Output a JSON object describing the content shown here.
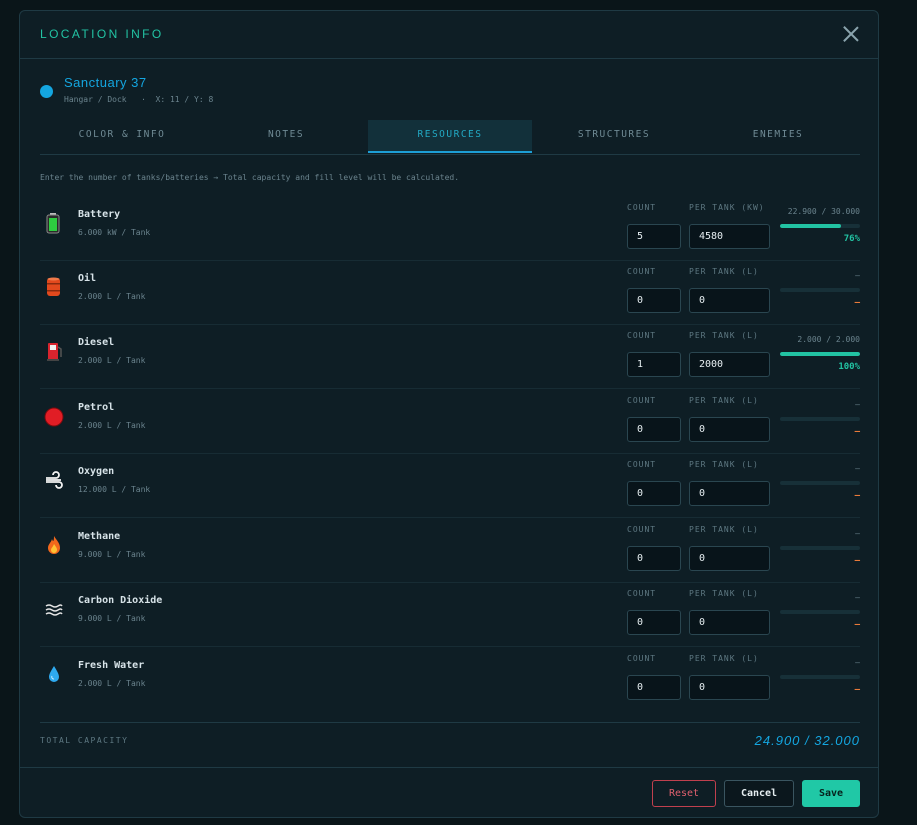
{
  "modal": {
    "title": "LOCATION INFO"
  },
  "location": {
    "name": "Sanctuary 37",
    "subtitle": "Hangar / Dock   ·  X: 11 / Y: 8",
    "color": "#14a6e0"
  },
  "tabs": [
    {
      "label": "COLOR & INFO",
      "active": false
    },
    {
      "label": "NOTES",
      "active": false
    },
    {
      "label": "RESOURCES",
      "active": true
    },
    {
      "label": "STRUCTURES",
      "active": false
    },
    {
      "label": "ENEMIES",
      "active": false
    }
  ],
  "hint": "Enter the number of tanks/batteries → Total capacity and fill level will be calculated.",
  "resources": [
    {
      "name": "Battery",
      "sub": "6.000 kW / Tank",
      "icon": "battery-icon",
      "count_label": "COUNT",
      "per_label": "PER TANK (KW)",
      "count": "5",
      "per": "4580",
      "fill": "22.900 / 30.000",
      "level": 0.76,
      "pct": "76%"
    },
    {
      "name": "Oil",
      "sub": "2.000 L / Tank",
      "icon": "oil-barrel-icon",
      "count_label": "COUNT",
      "per_label": "PER TANK (L)",
      "count": "0",
      "per": "0",
      "fill": "—",
      "level": 0,
      "pct": "—"
    },
    {
      "name": "Diesel",
      "sub": "2.000 L / Tank",
      "icon": "fuel-pump-icon",
      "count_label": "COUNT",
      "per_label": "PER TANK (L)",
      "count": "1",
      "per": "2000",
      "fill": "2.000 / 2.000",
      "level": 1.0,
      "pct": "100%"
    },
    {
      "name": "Petrol",
      "sub": "2.000 L / Tank",
      "icon": "red-circle-icon",
      "count_label": "COUNT",
      "per_label": "PER TANK (L)",
      "count": "0",
      "per": "0",
      "fill": "—",
      "level": 0,
      "pct": "—"
    },
    {
      "name": "Oxygen",
      "sub": "12.000 L / Tank",
      "icon": "wind-icon",
      "count_label": "COUNT",
      "per_label": "PER TANK (L)",
      "count": "0",
      "per": "0",
      "fill": "—",
      "level": 0,
      "pct": "—"
    },
    {
      "name": "Methane",
      "sub": "9.000 L / Tank",
      "icon": "flame-icon",
      "count_label": "COUNT",
      "per_label": "PER TANK (L)",
      "count": "0",
      "per": "0",
      "fill": "—",
      "level": 0,
      "pct": "—"
    },
    {
      "name": "Carbon Dioxide",
      "sub": "9.000 L / Tank",
      "icon": "fog-waves-icon",
      "count_label": "COUNT",
      "per_label": "PER TANK (L)",
      "count": "0",
      "per": "0",
      "fill": "—",
      "level": 0,
      "pct": "—"
    },
    {
      "name": "Fresh Water",
      "sub": "2.000 L / Tank",
      "icon": "water-drop-icon",
      "count_label": "COUNT",
      "per_label": "PER TANK (L)",
      "count": "0",
      "per": "0",
      "fill": "—",
      "level": 0,
      "pct": "—"
    }
  ],
  "total": {
    "label": "TOTAL CAPACITY",
    "value": "24.900 / 32.000"
  },
  "buttons": {
    "reset": "Reset",
    "cancel": "Cancel",
    "save": "Save"
  },
  "colors": {
    "accent": "#22c3a3",
    "primary": "#14a6e0",
    "danger": "#e0606e",
    "empty": "#e87a3a"
  }
}
